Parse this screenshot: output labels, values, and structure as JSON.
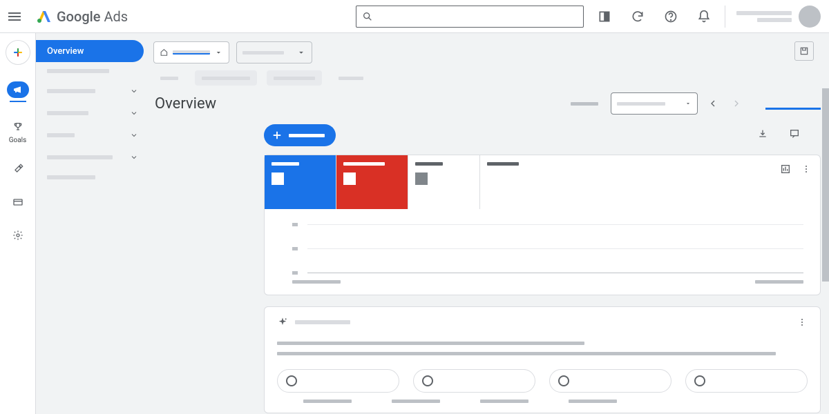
{
  "header": {
    "product_name_1": "Google",
    "product_name_2": "Ads"
  },
  "rail": {
    "items": [
      {
        "label": ""
      },
      {
        "label": "Goals"
      },
      {
        "label": ""
      },
      {
        "label": ""
      },
      {
        "label": ""
      }
    ]
  },
  "nav": {
    "active_label": "Overview"
  },
  "page": {
    "title": "Overview"
  }
}
